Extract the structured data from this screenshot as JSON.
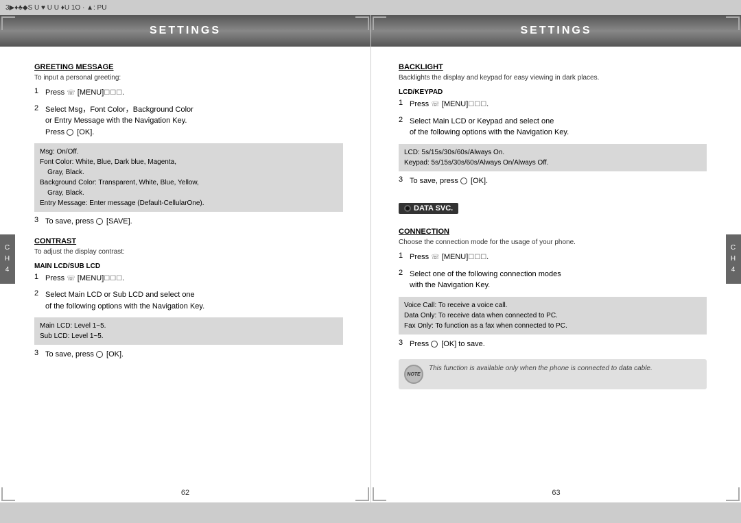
{
  "topbar": {
    "text": "3▶♦♣◆S U ♥ U   U  ♦U 1O · ▲: PU"
  },
  "leftPage": {
    "header": "SETTINGS",
    "section1": {
      "title": "GREETING MESSAGE",
      "subtitle": "To input a personal greeting:",
      "steps": [
        {
          "num": "1",
          "text": "Press  [MENU]   ."
        },
        {
          "num": "2",
          "text": "Select Msg，Font Color，Background Color or Entry Message  with the Navigation Key. Press  [OK]."
        }
      ],
      "infoBox": "Msg: On/Off.\nFont Color: White, Blue, Dark blue, Magenta,\n    Gray, Black.\nBackground Color: Transparent, White, Blue, Yellow,\n    Gray, Black.\nEntry Message: Enter message (Default-CellularOne).",
      "step3": "To save, press  [SAVE]."
    },
    "section2": {
      "title": "CONTRAST",
      "subtitle": "To adjust the display contrast:",
      "subsection": "MAIN LCD/SUB LCD",
      "steps": [
        {
          "num": "1",
          "text": "Press  [MENU]   ."
        },
        {
          "num": "2",
          "text": "Select Main LCD or Sub LCD  and select one of the following options with the Navigation Key."
        }
      ],
      "infoBox": "Main LCD: Level 1~5.\nSub LCD: Level 1~5.",
      "step3": "To save, press  [OK]."
    },
    "pageNum": "62",
    "chTab": "C\nH\n4"
  },
  "rightPage": {
    "header": "SETTINGS",
    "section1": {
      "title": "BACKLIGHT",
      "subtitle": "Backlights the display and keypad for easy viewing in dark places.",
      "subsection": "LCD/KEYPAD",
      "steps": [
        {
          "num": "1",
          "text": "Press  [MENU]   ."
        },
        {
          "num": "2",
          "text": "Select Main LCD or Keypad  and select one of the following options with the Navigation Key."
        }
      ],
      "infoBox": "LCD: 5s/15s/30s/60s/Always On.\nKeypad: 5s/15s/30s/60s/Always On/Always Off.",
      "step3": "To save, press  [OK]."
    },
    "section2": {
      "dataSvcLabel": "DATA SVC.",
      "title": "CONNECTION",
      "subtitle": "Choose the connection mode for the usage of your phone.",
      "steps": [
        {
          "num": "1",
          "text": "Press  [MENU]   ."
        },
        {
          "num": "2",
          "text": "Select one of the following connection modes with the Navigation Key."
        }
      ],
      "infoBox": "Voice Call: To receive a voice call.\nData Only: To receive data when connected to PC.\nFax Only: To function as a fax when connected to PC.",
      "step3": "Press  [OK] to save."
    },
    "noteText": "This function is available only when the phone is connected to data cable.",
    "noteLabel": "NOTE",
    "pageNum": "63",
    "chTab": "C\nH\n4"
  }
}
